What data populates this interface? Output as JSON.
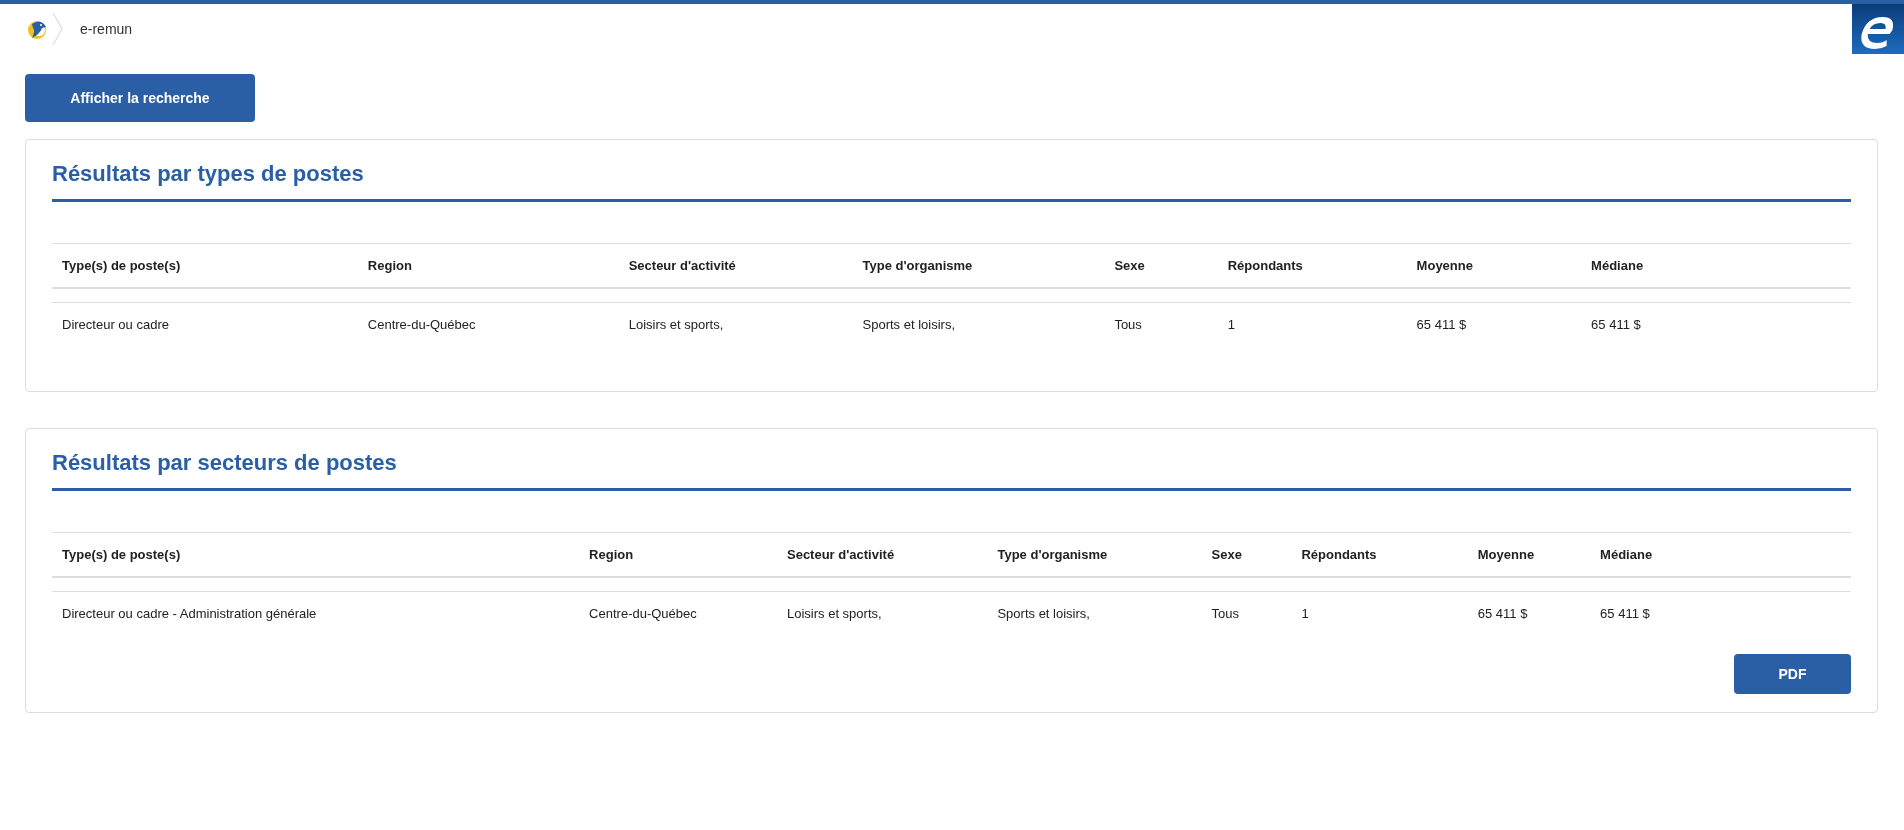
{
  "breadcrumb": {
    "label": "e-remun"
  },
  "search_button": {
    "label": "Afficher la recherche"
  },
  "sections": [
    {
      "title": "Résultats par types de postes",
      "table": {
        "columns": [
          "Type(s) de poste(s)",
          "Region",
          "Secteur d'activité",
          "Type d'organisme",
          "Sexe",
          "Répondants",
          "Moyenne",
          "Médiane"
        ],
        "rows": [
          [
            "Directeur ou cadre",
            "Centre-du-Québec",
            "Loisirs et sports,",
            "Sports et loisirs,",
            "Tous",
            "1",
            "65 411 $",
            "65 411 $"
          ]
        ]
      }
    },
    {
      "title": "Résultats par secteurs de postes",
      "table": {
        "columns": [
          "Type(s) de poste(s)",
          "Region",
          "Secteur d'activité",
          "Type d'organisme",
          "Sexe",
          "Répondants",
          "Moyenne",
          "Médiane"
        ],
        "rows": [
          [
            "Directeur ou cadre - Administration générale",
            "Centre-du-Québec",
            "Loisirs et sports,",
            "Sports et loisirs,",
            "Tous",
            "1",
            "65 411 $",
            "65 411 $"
          ]
        ]
      },
      "button": {
        "label": "PDF"
      }
    }
  ]
}
